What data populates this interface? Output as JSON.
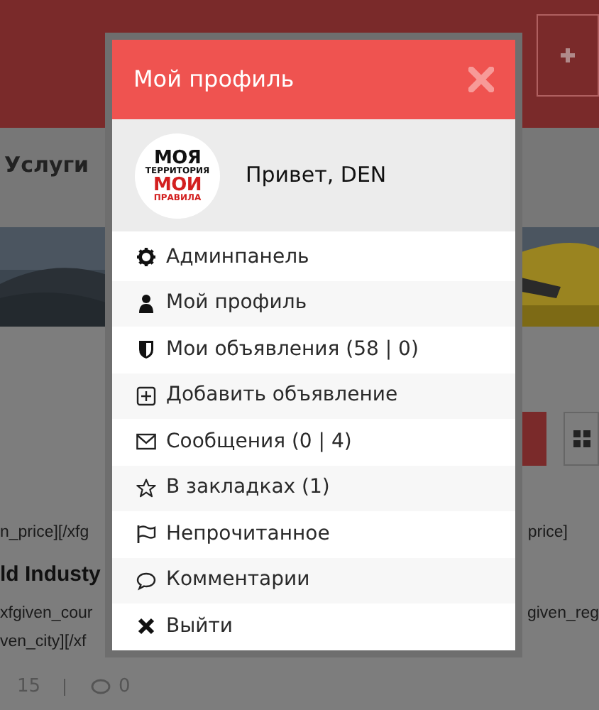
{
  "background": {
    "nav_item": "Услуги",
    "price_left": "n_price][/xfg",
    "price_right": "price]",
    "title": "ld Industy",
    "location_left": "xfgiven_cour",
    "location_right": "given_reg",
    "city": "ven_city][/xf",
    "views": "15",
    "comments": "0"
  },
  "modal": {
    "title": "Мой профиль",
    "avatar_lines": [
      "МОЯ",
      "ТЕРРИТОРИЯ",
      "МОИ",
      "ПРАВИЛА"
    ],
    "greeting": "Привет, DEN",
    "menu": [
      {
        "kind": "gear",
        "label": "Админпанель"
      },
      {
        "kind": "user",
        "label": "Мой профиль"
      },
      {
        "kind": "shield",
        "label": "Мои объявления (58 | 0)"
      },
      {
        "kind": "plus-square",
        "label": "Добавить объявление"
      },
      {
        "kind": "envelope",
        "label": "Сообщения (0 | 4)"
      },
      {
        "kind": "star",
        "label": "В закладках (1)"
      },
      {
        "kind": "flag",
        "label": "Непрочитанное"
      },
      {
        "kind": "comment",
        "label": "Комментарии"
      },
      {
        "kind": "cross",
        "label": "Выйти"
      }
    ]
  }
}
